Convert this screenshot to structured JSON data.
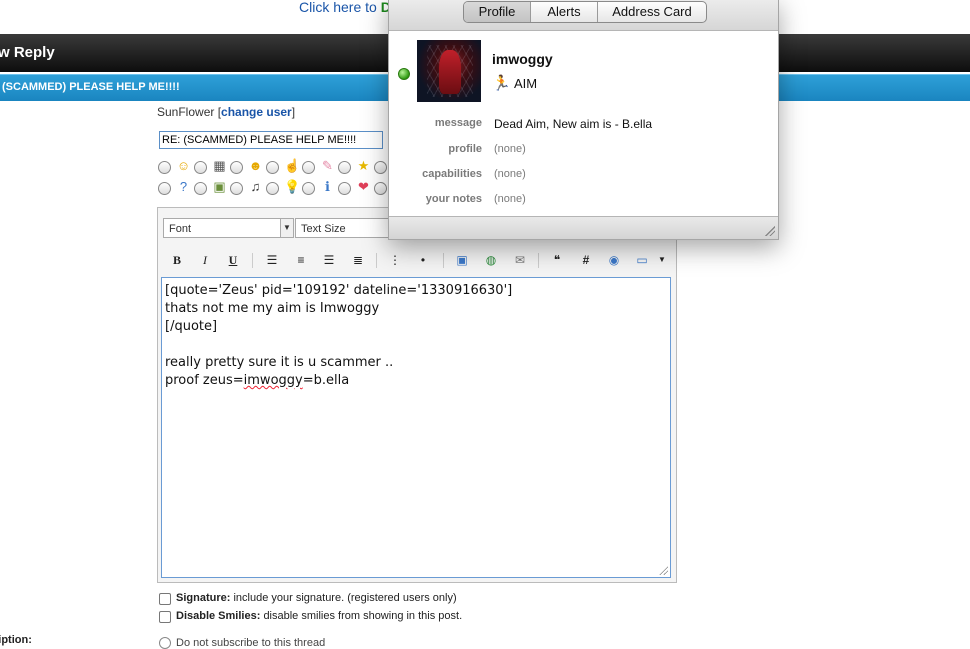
{
  "top_link": {
    "prefix": "Click here to ",
    "bold": "Do"
  },
  "reply_bar": {
    "title": "w Reply"
  },
  "thread_bar": {
    "title": "(SCAMMED) PLEASE HELP ME!!!!"
  },
  "user": {
    "name": "SunFlower",
    "change_label": "change user"
  },
  "post_title_value": "RE: (SCAMMED) PLEASE HELP ME!!!!",
  "editor": {
    "font_label": "Font",
    "size_label": "Text Size",
    "bold": "B",
    "italic": "I",
    "underline": "U",
    "hash": "#",
    "lines": [
      "[quote='Zeus' pid='109192' dateline='1330916630']",
      "thats not me my aim is Imwoggy",
      "[/quote]",
      "",
      "really pretty sure it is u scammer ..",
      "proof zeus="
    ],
    "misspelled": "imwoggy",
    "after_misspelled": "=b.ella"
  },
  "options": {
    "signature_label": "Signature:",
    "signature_desc": "include your signature. (registered users only)",
    "smilies_label": "Disable Smilies:",
    "smilies_desc": "disable smilies from showing in this post.",
    "subscription_label": "ription:",
    "subscription_choice": "Do not subscribe to this thread"
  },
  "popup": {
    "tabs": [
      "Profile",
      "Alerts",
      "Address Card"
    ],
    "active_tab": 0,
    "buddy_name": "imwoggy",
    "service": "AIM",
    "rows": [
      {
        "label": "message",
        "value": "Dead Aim, New aim is - B.ella"
      },
      {
        "label": "profile",
        "value": "(none)"
      },
      {
        "label": "capabilities",
        "value": "(none)"
      },
      {
        "label": "your notes",
        "value": "(none)"
      }
    ]
  },
  "colors": {
    "link": "#1a55a8",
    "thread_bar": "#1a85c0",
    "online": "#2f9a12"
  }
}
